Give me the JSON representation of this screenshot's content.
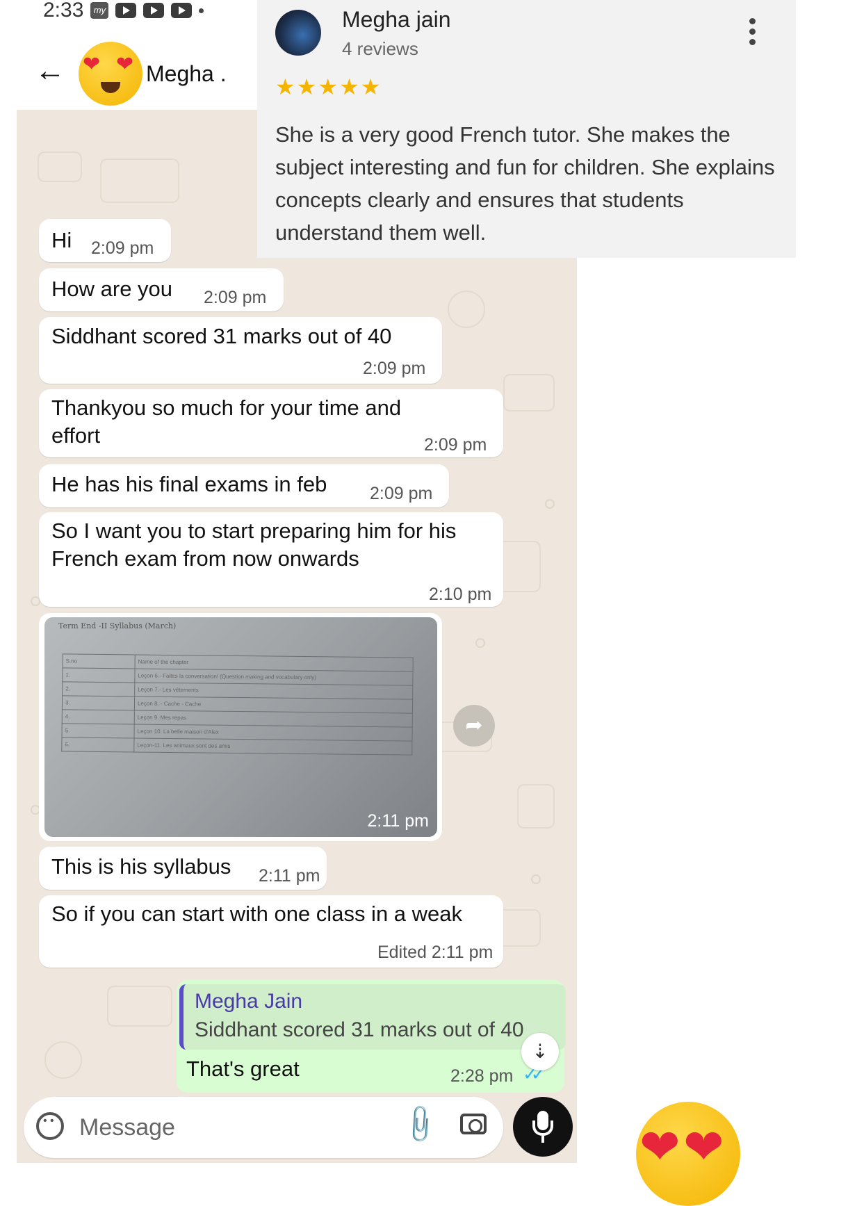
{
  "status_bar": {
    "time": "2:33"
  },
  "header": {
    "contact_name": "Megha ."
  },
  "review": {
    "reviewer_name": "Megha jain",
    "review_count": "4 reviews",
    "stars": "★★★★★",
    "rating": 5,
    "text": "She is a very good French tutor. She makes the subject interesting and fun for children. She explains concepts clearly and ensures that students understand them well."
  },
  "messages": [
    {
      "text": "Hi",
      "time": "2:09 pm"
    },
    {
      "text": "How are you",
      "time": "2:09 pm"
    },
    {
      "text": "Siddhant scored 31 marks out of 40",
      "time": "2:09 pm"
    },
    {
      "text": "Thankyou so much for your time and effort",
      "time": "2:09 pm"
    },
    {
      "text": "He has his final exams in feb",
      "time": "2:09 pm"
    },
    {
      "text": "So I want you to start preparing him for his French exam from now onwards",
      "time": "2:10 pm"
    },
    {
      "text": "This is his syllabus",
      "time": "2:11 pm"
    },
    {
      "text": "So if you can start with one class in a weak",
      "time": "Edited 2:11 pm"
    }
  ],
  "image_message": {
    "time": "2:11 pm",
    "sheet_title": "Term End -II Syllabus (March)",
    "col_sno": "S.no",
    "col_chapter": "Name of the chapter",
    "rows": [
      {
        "no": "1.",
        "chapter": "Leçon 6.- Faites la conversation! (Question making and vocabulary only)"
      },
      {
        "no": "2.",
        "chapter": "Leçon 7.- Les vêtements"
      },
      {
        "no": "3.",
        "chapter": "Leçon 8. - Cache - Cache"
      },
      {
        "no": "4.",
        "chapter": "Leçon 9. Mes repas"
      },
      {
        "no": "5.",
        "chapter": "Leçon 10. La belle maison d'Alex"
      },
      {
        "no": "6.",
        "chapter": "Leçon-11. Les animaux sont des amis"
      }
    ]
  },
  "sent_message": {
    "quoted_name": "Megha Jain",
    "quoted_text": "Siddhant scored 31 marks out of 40",
    "text": "That's great",
    "time": "2:28 pm",
    "tick_color": "#34b7f1"
  },
  "composer": {
    "placeholder": "Message"
  },
  "colors": {
    "chat_bg": "#efe7dd",
    "sent_bubble": "#d9fdd3",
    "star": "#f5b400"
  },
  "icons": [
    "back-arrow-icon",
    "more-vert-icon",
    "emoji-icon",
    "attach-icon",
    "camera-icon",
    "mic-icon",
    "forward-icon",
    "scroll-down-icon"
  ]
}
